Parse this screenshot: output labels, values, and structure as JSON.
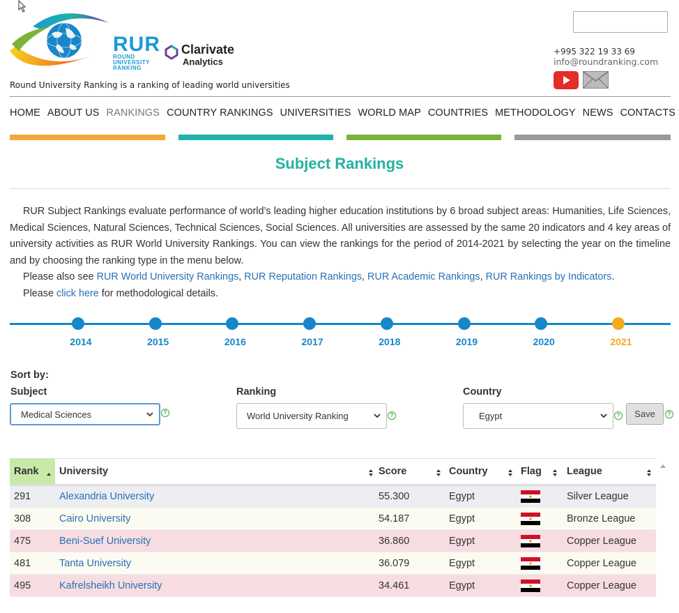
{
  "header": {
    "rur_logo_text": "RUR",
    "rur_logo_sub1": "ROUND",
    "rur_logo_sub2": "UNIVERSITY",
    "rur_logo_sub3": "RANKING",
    "clarivate_text": "Clarivate",
    "clarivate_sub": "Analytics",
    "tagline": "Round University Ranking is a ranking of leading world universities",
    "search_value": "",
    "phone": "+995 322 19 33 69",
    "email": "info@roundranking.com"
  },
  "nav": {
    "items": [
      {
        "label": "HOME"
      },
      {
        "label": "ABOUT US"
      },
      {
        "label": "RANKINGS",
        "active": true
      },
      {
        "label": "COUNTRY RANKINGS"
      },
      {
        "label": "UNIVERSITIES"
      },
      {
        "label": "WORLD MAP"
      },
      {
        "label": "COUNTRIES"
      },
      {
        "label": "METHODOLOGY"
      },
      {
        "label": "NEWS"
      },
      {
        "label": "CONTACTS"
      }
    ],
    "bar_colors": [
      "#f2a93b",
      "#1fb3a6",
      "#7ab43a",
      "#999999"
    ]
  },
  "page": {
    "title": "Subject Rankings",
    "intro": "RUR Subject Rankings evaluate performance of world’s leading higher education institutions by 6 broad subject areas: Humanities, Life Sciences, Medical Sciences, Natural Sciences, Technical Sciences, Social Sciences. All universities are assessed by the same 20 indicators and 4 key areas of university activities as RUR World University Rankings. You can view the rankings for the period of 2014-2021 by selecting the year on the timeline and by choosing the ranking type in the menu below.",
    "see_also_prefix": "Please also see ",
    "see_also_links": [
      "RUR World University Rankings",
      "RUR Reputation Rankings",
      "RUR Academic Rankings",
      "RUR Rankings by Indicators"
    ],
    "sep": ", ",
    "see_also_end": ".",
    "method_prefix": "Please ",
    "method_link": "click here",
    "method_suffix": " for methodological details."
  },
  "timeline": {
    "years": [
      "2014",
      "2015",
      "2016",
      "2017",
      "2018",
      "2019",
      "2020",
      "2021"
    ],
    "active": "2021",
    "colors": {
      "line": "#1787c9",
      "active": "#f5ab1e"
    }
  },
  "filters": {
    "sort_by_label": "Sort by:",
    "subject_label": "Subject",
    "subject_value": "Medical Sciences",
    "ranking_label": "Ranking",
    "ranking_value": "World University Ranking",
    "country_label": "Country",
    "country_value": "Egypt",
    "help_glyph": "?",
    "save_label": "Save"
  },
  "table": {
    "headers": [
      "Rank",
      "University",
      "Score",
      "Country",
      "Flag",
      "League"
    ],
    "rows": [
      {
        "rank": "291",
        "university": "Alexandria University",
        "score": "55.300",
        "country": "Egypt",
        "league": "Silver League",
        "bg": "#eceef1"
      },
      {
        "rank": "308",
        "university": "Cairo University",
        "score": "54.187",
        "country": "Egypt",
        "league": "Bronze League",
        "bg": "#fbfbf2"
      },
      {
        "rank": "475",
        "university": "Beni-Suef University",
        "score": "36.860",
        "country": "Egypt",
        "league": "Copper League",
        "bg": "#f7dde2"
      },
      {
        "rank": "481",
        "university": "Tanta University",
        "score": "36.079",
        "country": "Egypt",
        "league": "Copper League",
        "bg": "#fbfbf2"
      },
      {
        "rank": "495",
        "university": "Kafrelsheikh University",
        "score": "34.461",
        "country": "Egypt",
        "league": "Copper League",
        "bg": "#f7dde2"
      }
    ]
  }
}
